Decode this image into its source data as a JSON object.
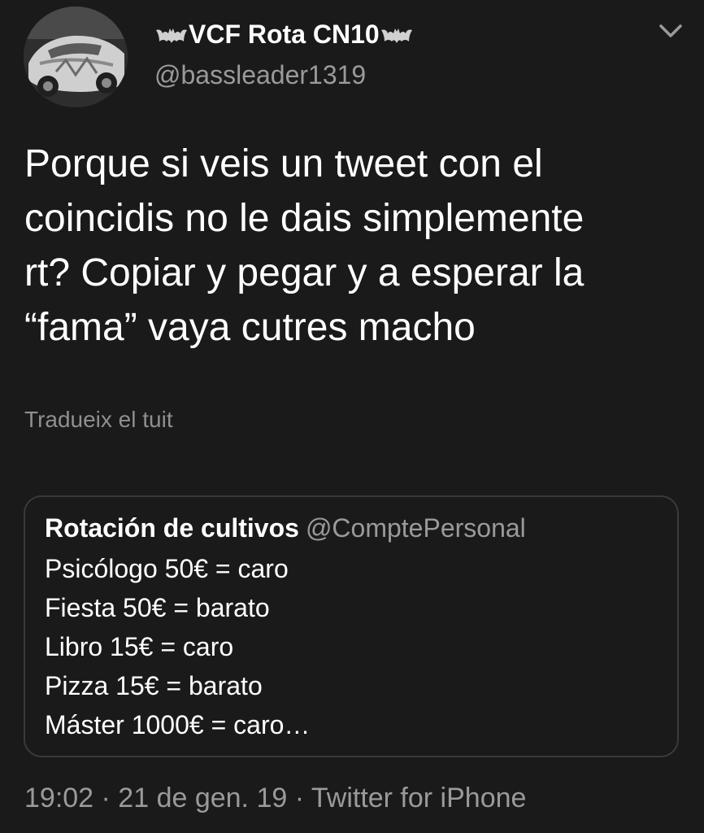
{
  "tweet": {
    "display_name": "VCF Rota CN10",
    "handle": "@bassleader1319",
    "text": "Porque si veis un tweet con el\ncoincidis no le dais simplemente\nrt? Copiar y pegar y a esperar la\n“fama” vaya cutres macho",
    "translate_label": "Tradueix el tuit",
    "meta": "19:02 · 21 de gen. 19 · Twitter for iPhone"
  },
  "quoted_tweet": {
    "display_name": "Rotación de cultivos",
    "handle": "@ComptePersonal",
    "lines": [
      "Psicólogo 50€ = caro",
      "Fiesta 50€ = barato",
      "Libro 15€ = caro",
      "Pizza 15€ = barato",
      "Máster 1000€ = caro…"
    ]
  },
  "icons": {
    "avatar": "car-avatar-photo",
    "name_prefix": "bat-icon",
    "name_suffix": "bat-icon",
    "menu": "chevron-down-icon"
  },
  "colors": {
    "background": "#1a1a1a",
    "primary_text": "#ffffff",
    "secondary_text": "#9a9a9a",
    "border": "#3a3a3a"
  }
}
